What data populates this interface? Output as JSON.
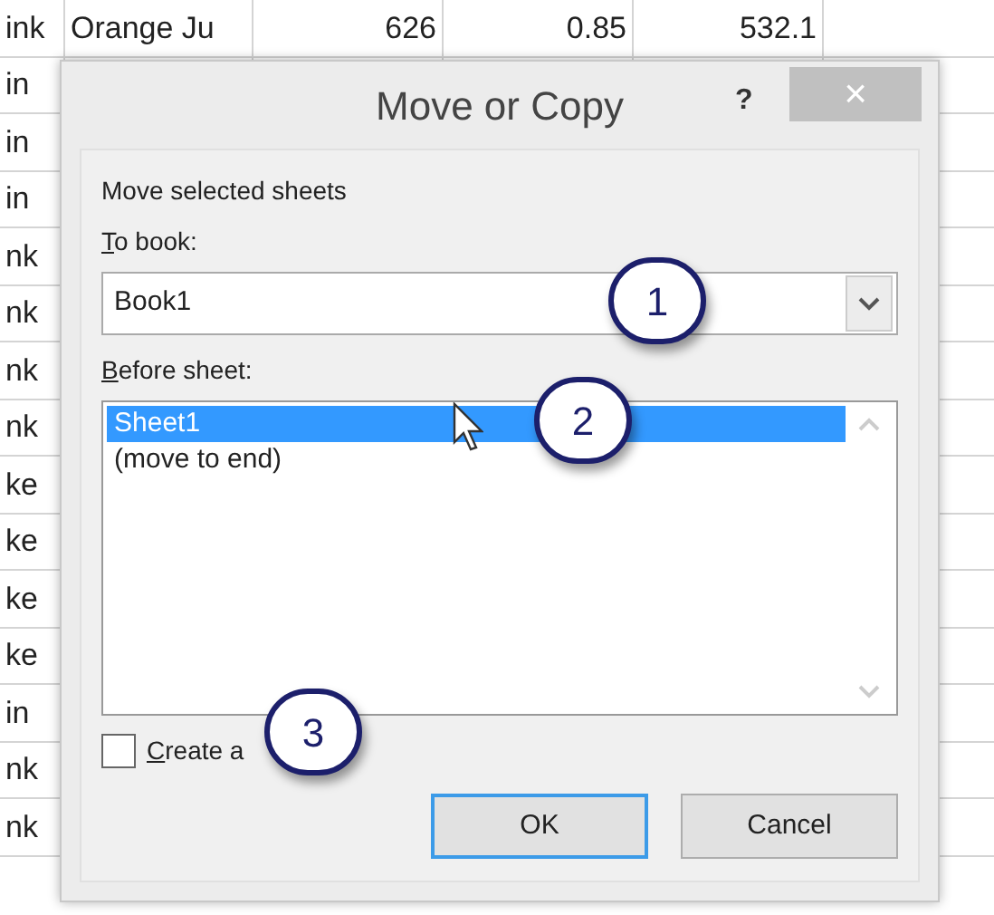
{
  "sheet": {
    "rows": [
      {
        "cells": [
          "ink",
          "Orange Ju",
          "626",
          "0.85",
          "532.1"
        ]
      },
      {
        "cells": [
          "in"
        ]
      },
      {
        "cells": [
          "in"
        ]
      },
      {
        "cells": [
          "in"
        ]
      },
      {
        "cells": [
          "nk"
        ]
      },
      {
        "cells": [
          "nk"
        ]
      },
      {
        "cells": [
          "nk"
        ]
      },
      {
        "cells": [
          "nk"
        ]
      },
      {
        "cells": [
          "ke"
        ]
      },
      {
        "cells": [
          "ke"
        ]
      },
      {
        "cells": [
          "ke"
        ]
      },
      {
        "cells": [
          "ke"
        ]
      },
      {
        "cells": [
          "in"
        ]
      },
      {
        "cells": [
          "nk"
        ]
      },
      {
        "cells": [
          "nk"
        ]
      }
    ]
  },
  "dialog": {
    "title": "Move or Copy",
    "help": "?",
    "close": "×",
    "heading": "Move selected sheets",
    "to_book": {
      "label": "To book:",
      "value": "Book1"
    },
    "before_sheet": {
      "label": "Before sheet:",
      "items": [
        {
          "label": "Sheet1",
          "selected": true
        },
        {
          "label": "(move to end)",
          "selected": false
        }
      ]
    },
    "create_copy": {
      "label": "Create a",
      "checked": false
    },
    "buttons": [
      {
        "label": "OK",
        "default": true
      },
      {
        "label": "Cancel",
        "default": false
      }
    ]
  },
  "callouts": [
    "1",
    "2",
    "3"
  ]
}
